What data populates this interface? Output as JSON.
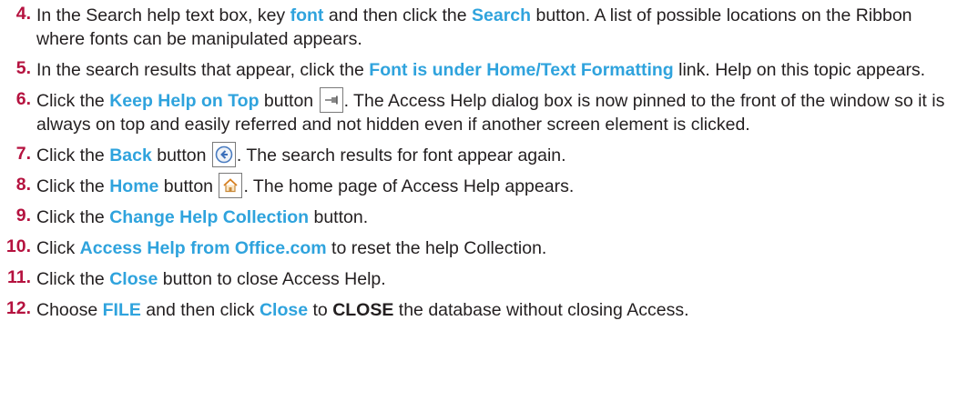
{
  "steps": [
    {
      "number": "4.",
      "t1": "In the Search help text box, key ",
      "h1": "font",
      "t2": " and then click the ",
      "h2": "Search",
      "t3": " button. A list of possible locations on the Ribbon where fonts can be manipulated appears."
    },
    {
      "number": "5.",
      "t1": "In the search results that appear, click the ",
      "h1": "Font is under Home/Text Formatting",
      "t2": " link. Help on this topic appears."
    },
    {
      "number": "6.",
      "t1": "Click the ",
      "h1": "Keep Help on Top",
      "t2": " button ",
      "icon": "pin-icon",
      "t3": ". The Access Help dialog box is now pinned to the front of the window so it is always on top and easily referred and not hidden even if another screen element is clicked."
    },
    {
      "number": "7.",
      "t1": "Click the ",
      "h1": "Back",
      "t2": " button ",
      "icon": "back-arrow-icon",
      "t3": ". The search results for font appear again."
    },
    {
      "number": "8.",
      "t1": "Click the ",
      "h1": "Home",
      "t2": " button ",
      "icon": "home-icon",
      "t3": ". The home page of Access Help appears."
    },
    {
      "number": "9.",
      "t1": "Click the ",
      "h1": "Change Help Collection",
      "t2": " button."
    },
    {
      "number": "10.",
      "t1": "Click ",
      "h1": "Access Help from Office.com",
      "t2": " to reset the help Collection."
    },
    {
      "number": "11.",
      "t1": "Click the ",
      "h1": "Close",
      "t2": " button to close Access Help."
    },
    {
      "number": "12.",
      "t1": "Choose ",
      "h1": "FILE",
      "t2": " and then click ",
      "h2": "Close",
      "t3": " to ",
      "s1": "CLOSE",
      "t4": " the database without closing Access."
    }
  ],
  "colors": {
    "step_number": "#b5123f",
    "highlight": "#2fa3dd",
    "text": "#231f20"
  }
}
